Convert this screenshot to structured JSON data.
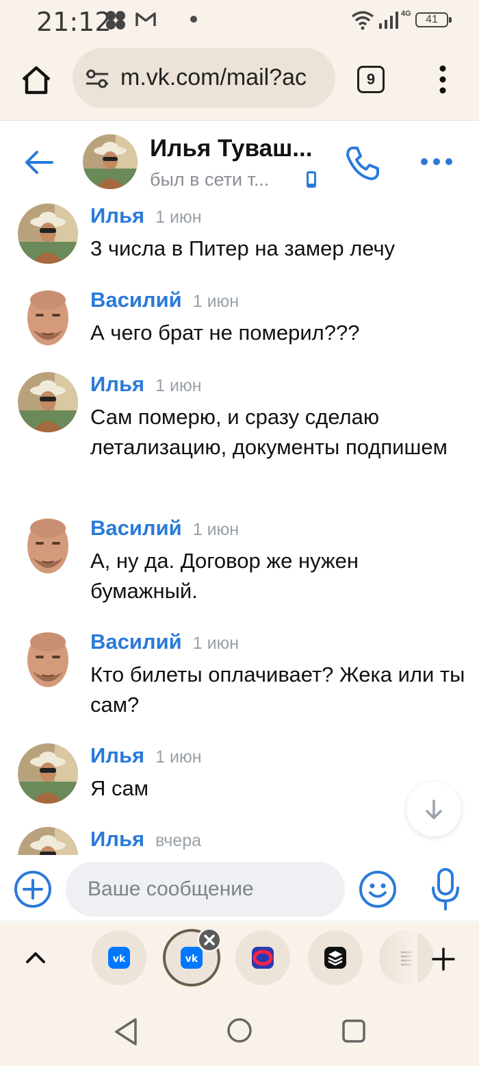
{
  "status_bar": {
    "time": "21:12",
    "network": "4G",
    "battery": "41"
  },
  "browser": {
    "url": "m.vk.com/mail?ac",
    "tab_count": "9"
  },
  "chat": {
    "title": "Илья Туваш...",
    "status": "был в сети т..."
  },
  "messages": [
    {
      "author": "Илья",
      "date": "1 июн",
      "text": "3 числа в Питер на замер лечу",
      "avatar": "ilya"
    },
    {
      "author": "Василий",
      "date": "1 июн",
      "text": "А чего брат не померил???",
      "avatar": "vasily"
    },
    {
      "author": "Илья",
      "date": "1 июн",
      "text": "Сам померю, и сразу сделаю летализацию, документы подпишем",
      "avatar": "ilya"
    },
    {
      "author": "Василий",
      "date": "1 июн",
      "text": "А, ну да. Договор же нужен бумажный.",
      "avatar": "vasily"
    },
    {
      "author": "Василий",
      "date": "1 июн",
      "text": "Кто билеты оплачивает? Жека или ты сам?",
      "avatar": "vasily"
    },
    {
      "author": "Илья",
      "date": "1 июн",
      "text": "Я сам",
      "avatar": "ilya"
    },
    {
      "author": "Илья",
      "date": "вчера",
      "text": "",
      "avatar": "ilya"
    }
  ],
  "composer": {
    "placeholder": "Ваше сообщение"
  },
  "colors": {
    "accent": "#2a7ad9",
    "browser_chrome": "#f9f2ea"
  },
  "icons": [
    "home-icon",
    "tune-icon",
    "kebab-menu-icon",
    "back-arrow-icon",
    "phone-icon",
    "more-dots-icon",
    "mobile-icon",
    "scroll-down-icon",
    "attach-plus-icon",
    "emoji-icon",
    "microphone-icon",
    "vk-icon",
    "opera-icon",
    "layers-icon",
    "plus-icon"
  ]
}
